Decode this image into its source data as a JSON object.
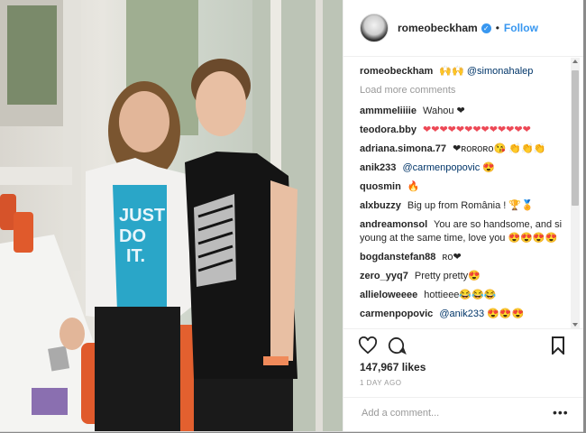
{
  "header": {
    "username": "romeobeckham",
    "verified_icon": "verified-badge-icon",
    "separator": "•",
    "follow_label": "Follow"
  },
  "caption": {
    "username": "romeobeckham",
    "emojis": "🙌🙌",
    "mention": "@simonahalep"
  },
  "load_more": "Load more comments",
  "comments": [
    {
      "user": "ammmeliiiie",
      "text": "Wahou ❤"
    },
    {
      "user": "teodora.bby",
      "text": "❤❤❤❤❤❤❤❤❤❤❤❤❤"
    },
    {
      "user": "adriana.simona.77",
      "text": "❤ʀᴏʀᴏʀᴏ😘 👏👏👏"
    },
    {
      "user": "anik233",
      "text": "@carmenpopovic 😍"
    },
    {
      "user": "quosmin",
      "text": "🔥"
    },
    {
      "user": "alxbuzzy",
      "text": "Big up from România ! 🏆🏅"
    },
    {
      "user": "andreamonsol",
      "text": "You are so handsome, and si young at the same time, love you 😍😍😍😍"
    },
    {
      "user": "bogdanstefan88",
      "text": "ʀᴏ❤"
    },
    {
      "user": "zero_yyq7",
      "text": "Pretty pretty😍"
    },
    {
      "user": "allieloweeee",
      "text": "hottieee😂😂😂"
    },
    {
      "user": "carmenpopovic",
      "text": "@anik233 😍😍😍"
    }
  ],
  "actions": {
    "like_icon": "heart-icon",
    "comment_icon": "comment-icon",
    "save_icon": "bookmark-icon"
  },
  "likes": "147,967 likes",
  "time": "1 DAY AGO",
  "add_comment_placeholder": "Add a comment...",
  "more_options": "•••",
  "colors": {
    "link": "#003569",
    "follow": "#3897f0",
    "text": "#262626",
    "muted": "#999999"
  }
}
